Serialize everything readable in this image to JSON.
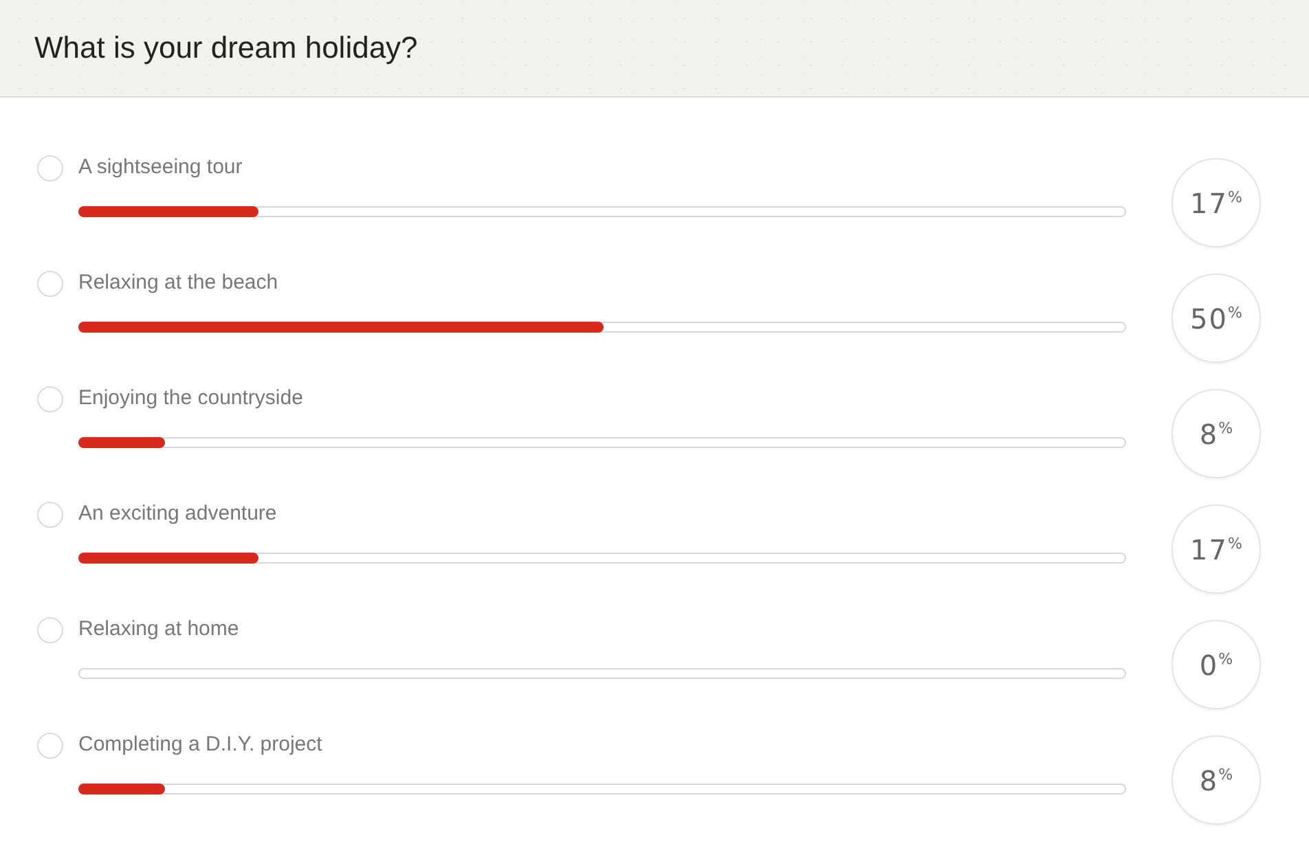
{
  "question": {
    "title": "What is your dream holiday?"
  },
  "options": [
    {
      "label": "A sightseeing tour",
      "selected": false,
      "level": 0.17,
      "result": "17$^{%}$"
    },
    {
      "label": "Relaxing at the beach",
      "selected": false,
      "level": 0.5,
      "result": "50$^{%}$"
    },
    {
      "label": "Enjoying the countryside",
      "selected": false,
      "level": 0.08,
      "result": "8$^{%}$"
    },
    {
      "label": "An exciting adventure",
      "selected": false,
      "level": 0.17,
      "result": "17$^{%}$"
    },
    {
      "label": "Relaxing at home",
      "selected": false,
      "level": 0,
      "result": "0$^{%}$"
    },
    {
      "label": "Completing a D.I.Y. project",
      "selected": false,
      "level": 0.08,
      "result": "8$^{%}$"
    }
  ]
}
